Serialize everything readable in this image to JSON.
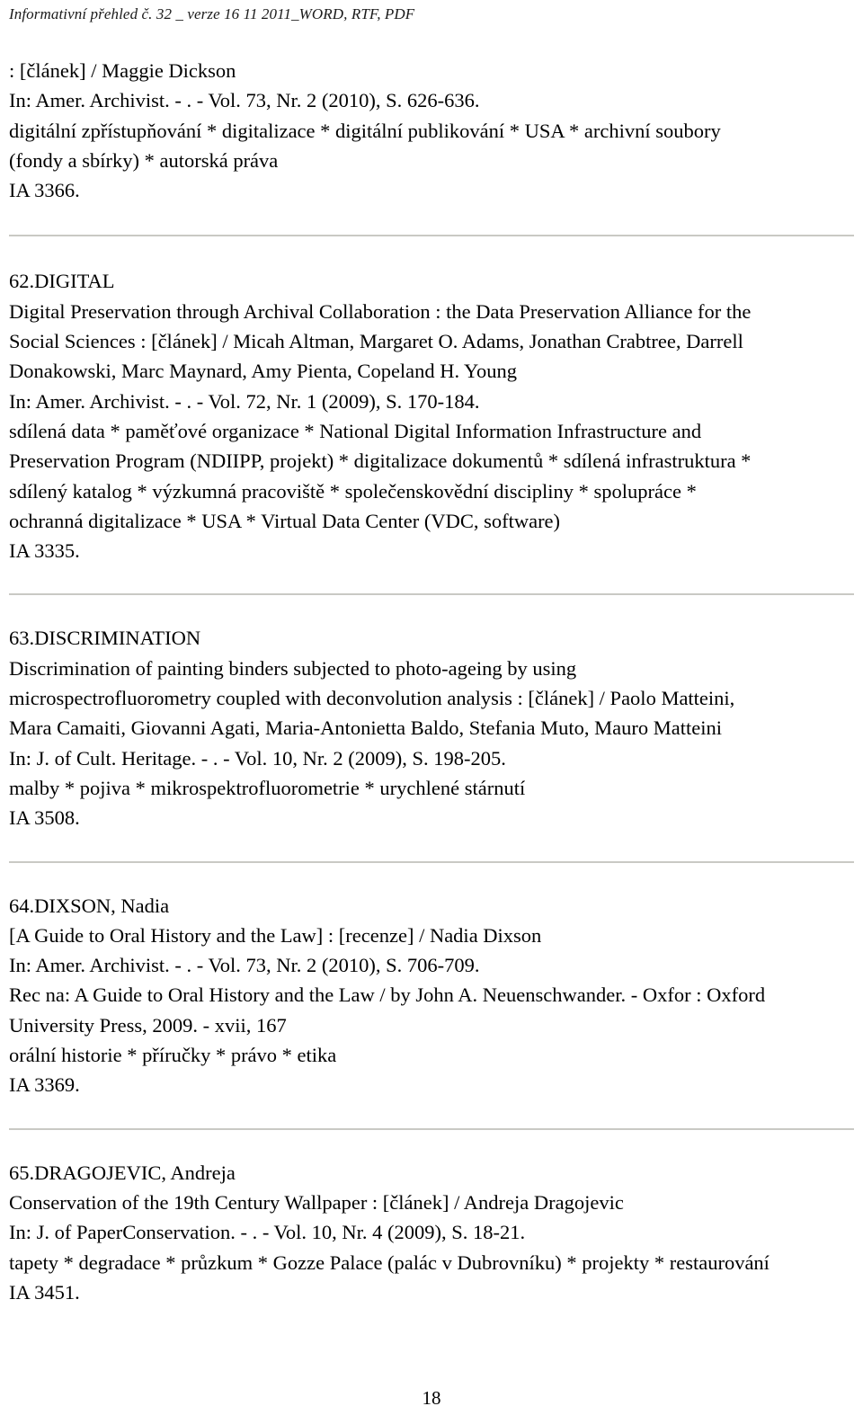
{
  "header": {
    "running_title": "Informativní přehled č. 32 _ verze 16 11 2011_WORD, RTF, PDF"
  },
  "footer": {
    "page_number": "18"
  },
  "records": [
    {
      "heading": "",
      "lines": [
        ": [článek] / Maggie Dickson",
        "In: Amer. Archivist. - . - Vol. 73, Nr. 2 (2010), S. 626-636.",
        "digitální zpřístupňování * digitalizace * digitální publikování * USA * archivní soubory",
        "(fondy a sbírky) * autorská práva",
        "IA 3366."
      ]
    },
    {
      "heading": "62.DIGITAL",
      "lines": [
        "Digital Preservation through Archival Collaboration : the Data Preservation Alliance for the",
        "Social Sciences : [článek] / Micah Altman, Margaret O. Adams, Jonathan Crabtree, Darrell",
        "Donakowski, Marc Maynard, Amy Pienta, Copeland H. Young",
        "In: Amer. Archivist. - . - Vol. 72, Nr. 1 (2009), S. 170-184.",
        "sdílená data * paměťové organizace * National Digital Information Infrastructure and",
        "Preservation Program (NDIIPP, projekt) * digitalizace dokumentů * sdílená infrastruktura *",
        "sdílený katalog * výzkumná pracoviště * společenskovědní discipliny * spolupráce *",
        "ochranná digitalizace * USA * Virtual Data Center (VDC, software)",
        "IA 3335."
      ]
    },
    {
      "heading": "63.DISCRIMINATION",
      "lines": [
        "Discrimination of painting binders subjected to photo-ageing by using",
        "microspectrofluorometry coupled with deconvolution analysis : [článek] / Paolo Matteini,",
        "Mara Camaiti, Giovanni Agati, Maria-Antonietta Baldo, Stefania Muto, Mauro Matteini",
        "In: J. of Cult. Heritage. - . - Vol. 10, Nr. 2 (2009), S. 198-205.",
        "malby * pojiva * mikrospektrofluorometrie * urychlené stárnutí",
        "IA 3508."
      ]
    },
    {
      "heading": "64.DIXSON, Nadia",
      "lines": [
        "[A Guide to Oral History and the Law] : [recenze] / Nadia Dixson",
        "In: Amer. Archivist. - . - Vol. 73, Nr. 2 (2010), S. 706-709.",
        "Rec na: A Guide to Oral History and the Law / by John A. Neuenschwander. - Oxfor : Oxford",
        "University Press, 2009. - xvii, 167",
        "orální historie * příručky * právo * etika",
        "IA 3369."
      ]
    },
    {
      "heading": "65.DRAGOJEVIC, Andreja",
      "lines": [
        "Conservation of the 19th Century Wallpaper : [článek] / Andreja Dragojevic",
        "In: J. of PaperConservation. - . - Vol. 10, Nr. 4 (2009), S. 18-21.",
        "tapety * degradace * průzkum * Gozze Palace (palác v Dubrovníku) * projekty * restaurování",
        "IA 3451."
      ]
    }
  ],
  "colors": {
    "text": "#000000",
    "separator": "#c9c9c4",
    "background": "#ffffff"
  }
}
